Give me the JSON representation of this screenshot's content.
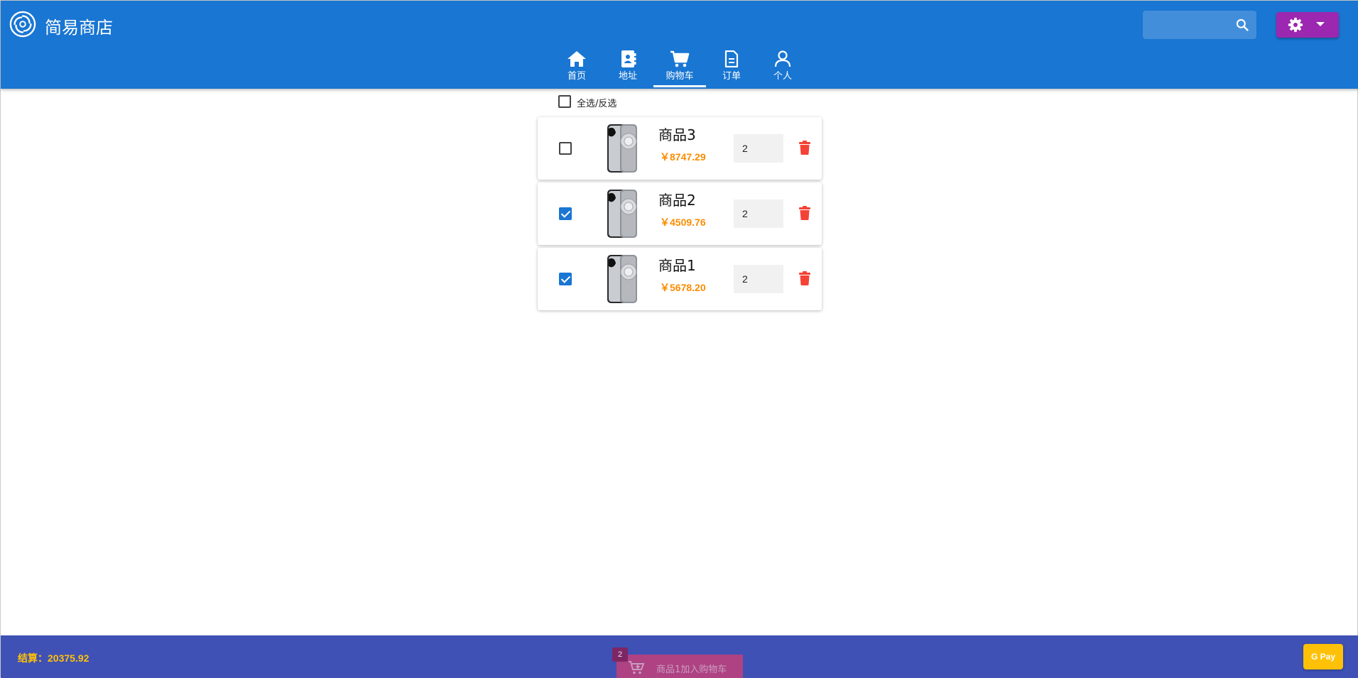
{
  "app": {
    "brand": "简易商店",
    "colors": {
      "primary": "#1976d2",
      "secondary": "#9c27b0",
      "footer": "#3f51b5",
      "price": "#fb8c00",
      "total": "#ffc107",
      "danger": "#f44336"
    }
  },
  "search": {
    "placeholder": "",
    "icon": "search-icon"
  },
  "settings": {
    "icon": "gear-icon"
  },
  "nav": [
    {
      "label": "首页",
      "icon": "home-icon"
    },
    {
      "label": "地址",
      "icon": "address-book-icon"
    },
    {
      "label": "购物车",
      "icon": "cart-icon",
      "active": true
    },
    {
      "label": "订单",
      "icon": "document-icon"
    },
    {
      "label": "个人",
      "icon": "person-icon"
    }
  ],
  "cart": {
    "select_all_label": "全选/反选",
    "items": [
      {
        "name": "商品3",
        "price": "￥8747.29",
        "qty": "2",
        "checked": false
      },
      {
        "name": "商品2",
        "price": "￥4509.76",
        "qty": "2",
        "checked": true
      },
      {
        "name": "商品1",
        "price": "￥5678.20",
        "qty": "2",
        "checked": true
      }
    ]
  },
  "footer": {
    "total": "结算：20375.92",
    "toast_badge": "2",
    "toast_message": "商品1加入购物车",
    "pay_label": "G Pay"
  }
}
